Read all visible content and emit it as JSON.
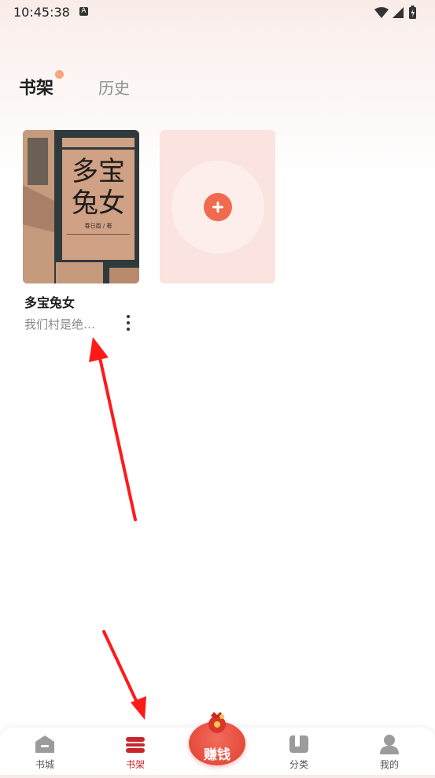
{
  "status_bar": {
    "time": "10:45:38",
    "notification_badge": "A"
  },
  "tabs": {
    "bookshelf_label": "书架",
    "history_label": "历史"
  },
  "book": {
    "title": "多宝兔女",
    "excerpt": "我们村是绝…",
    "cover_title": "多宝兔女",
    "cover_author": "春日酉 / 著"
  },
  "bottom_nav": {
    "items": [
      {
        "label": "书城",
        "icon": "bookstore-icon"
      },
      {
        "label": "书架",
        "icon": "bookshelf-icon",
        "active": true
      },
      {
        "label": "赚钱",
        "icon": "money-bag-icon"
      },
      {
        "label": "分类",
        "icon": "category-icon"
      },
      {
        "label": "我的",
        "icon": "profile-icon"
      }
    ]
  },
  "colors": {
    "accent": "#c8252d",
    "add_button": "#f06a50",
    "earn_button": "#e0402f",
    "annotation_arrow": "#ff1a1a"
  }
}
